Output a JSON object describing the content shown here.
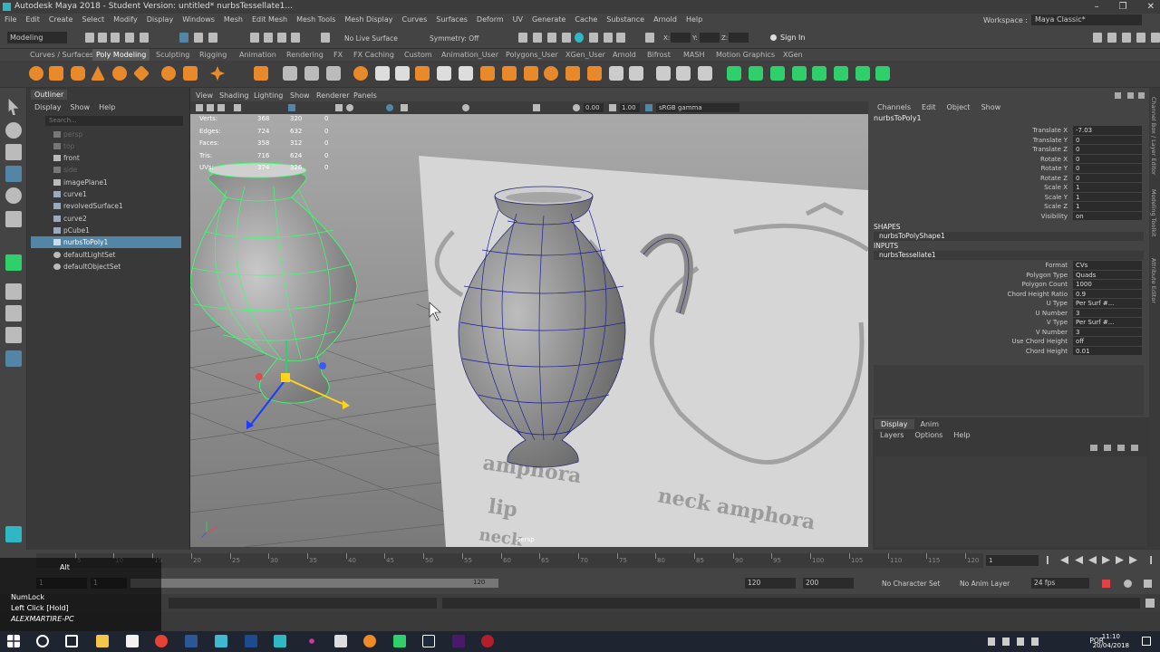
{
  "window": {
    "title": "Autodesk Maya 2018 - Student Version: untitled*    nurbsTessellate1...",
    "controls": [
      "–",
      "❐",
      "✕"
    ]
  },
  "menubar": [
    "File",
    "Edit",
    "Create",
    "Select",
    "Modify",
    "Display",
    "Windows",
    "Mesh",
    "Edit Mesh",
    "Mesh Tools",
    "Mesh Display",
    "Curves",
    "Surfaces",
    "Deform",
    "UV",
    "Generate",
    "Cache",
    "Substance",
    "Arnold",
    "Help"
  ],
  "workspace": {
    "label": "Workspace :",
    "value": "Maya Classic*"
  },
  "statusline": {
    "mode": "Modeling",
    "live_surface": "No Live Surface",
    "symmetry": "Symmetry: Off",
    "x_label": "X:",
    "y_label": "Y:",
    "z_label": "Z:",
    "sign_in": "Sign In"
  },
  "shelf_tabs": [
    "Curves / Surfaces",
    "Poly Modeling",
    "Sculpting",
    "Rigging",
    "Animation",
    "Rendering",
    "FX",
    "FX Caching",
    "Custom",
    "Animation_User",
    "Polygons_User",
    "XGen_User",
    "Arnold",
    "Bifrost",
    "MASH",
    "Motion Graphics",
    "XGen"
  ],
  "shelf_active": "Poly Modeling",
  "outliner": {
    "tab": "Outliner",
    "menu": [
      "Display",
      "Show",
      "Help"
    ],
    "search_placeholder": "Search...",
    "items": [
      {
        "label": "persp",
        "dim": true
      },
      {
        "label": "top",
        "dim": true
      },
      {
        "label": "front",
        "dim": false
      },
      {
        "label": "side",
        "dim": true
      },
      {
        "label": "imagePlane1",
        "dim": false
      },
      {
        "label": "curve1",
        "dim": false
      },
      {
        "label": "revolvedSurface1",
        "dim": false
      },
      {
        "label": "curve2",
        "dim": false
      },
      {
        "label": "pCube1",
        "dim": false
      },
      {
        "label": "nurbsToPoly1",
        "dim": false,
        "selected": true
      },
      {
        "label": "defaultLightSet",
        "dim": false
      },
      {
        "label": "defaultObjectSet",
        "dim": false
      }
    ]
  },
  "viewport": {
    "menu": [
      "View",
      "Shading",
      "Lighting",
      "Show",
      "Renderer",
      "Panels"
    ],
    "near_clip": "0.00",
    "far_clip": "1.00",
    "color_space": "sRGB gamma",
    "camera_label": "persp",
    "hud": [
      {
        "label": "Verts:",
        "a": "368",
        "b": "320",
        "c": "0"
      },
      {
        "label": "Edges:",
        "a": "724",
        "b": "632",
        "c": "0"
      },
      {
        "label": "Faces:",
        "a": "358",
        "b": "312",
        "c": "0"
      },
      {
        "label": "Tris:",
        "a": "716",
        "b": "624",
        "c": "0"
      },
      {
        "label": "UVs:",
        "a": "374",
        "b": "326",
        "c": "0"
      }
    ],
    "reference_words": [
      "amphora",
      "lip",
      "neck amphora",
      "neck"
    ]
  },
  "channelbox": {
    "menu": [
      "Channels",
      "Edit",
      "Object",
      "Show"
    ],
    "object": "nurbsToPoly1",
    "transforms": [
      {
        "name": "Translate X",
        "value": "-7.03"
      },
      {
        "name": "Translate Y",
        "value": "0"
      },
      {
        "name": "Translate Z",
        "value": "0"
      },
      {
        "name": "Rotate X",
        "value": "0"
      },
      {
        "name": "Rotate Y",
        "value": "0"
      },
      {
        "name": "Rotate Z",
        "value": "0"
      },
      {
        "name": "Scale X",
        "value": "1"
      },
      {
        "name": "Scale Y",
        "value": "1"
      },
      {
        "name": "Scale Z",
        "value": "1"
      },
      {
        "name": "Visibility",
        "value": "on"
      }
    ],
    "shapes_header": "SHAPES",
    "shape_node": "nurbsToPolyShape1",
    "inputs_header": "INPUTS",
    "input_node": "nurbsTessellate1",
    "inputs": [
      {
        "name": "Format",
        "value": "CVs"
      },
      {
        "name": "Polygon Type",
        "value": "Quads"
      },
      {
        "name": "Polygon Count",
        "value": "1000"
      },
      {
        "name": "Chord Height Ratio",
        "value": "0.9"
      },
      {
        "name": "U Type",
        "value": "Per Surf #..."
      },
      {
        "name": "U Number",
        "value": "3"
      },
      {
        "name": "V Type",
        "value": "Per Surf #..."
      },
      {
        "name": "V Number",
        "value": "3"
      },
      {
        "name": "Use Chord Height",
        "value": "off"
      },
      {
        "name": "Chord Height",
        "value": "0.01"
      }
    ]
  },
  "layers": {
    "tabs": [
      "Display",
      "Anim"
    ],
    "menu": [
      "Layers",
      "Options",
      "Help"
    ]
  },
  "side_tabs": [
    "Channel Box / Layer Editor",
    "Modeling Toolkit",
    "Attribute Editor"
  ],
  "timeline": {
    "ticks": [
      "5",
      "10",
      "15",
      "20",
      "25",
      "30",
      "35",
      "40",
      "45",
      "50",
      "55",
      "60",
      "65",
      "70",
      "75",
      "80",
      "85",
      "90",
      "95",
      "100",
      "105",
      "110",
      "115",
      "120"
    ],
    "current_frame": "1"
  },
  "range": {
    "start": "1",
    "inner_start": "1",
    "inner_end": "120",
    "end": "120",
    "max": "200",
    "character_set": "No Character Set",
    "anim_layer": "No Anim Layer",
    "fps": "24 fps"
  },
  "overlay": {
    "key": "Alt",
    "lines": [
      "NumLock",
      "Left Click [Hold]",
      "ALEXMARTIRE-PC"
    ]
  },
  "taskbar": {
    "lang": "POR",
    "time": "11:10",
    "date": "20/04/2018"
  },
  "colors": {
    "selection": "#5285a6",
    "accent_green": "#2fd06c",
    "wire_green": "#3cff6e",
    "wire_blue": "#2222aa"
  }
}
